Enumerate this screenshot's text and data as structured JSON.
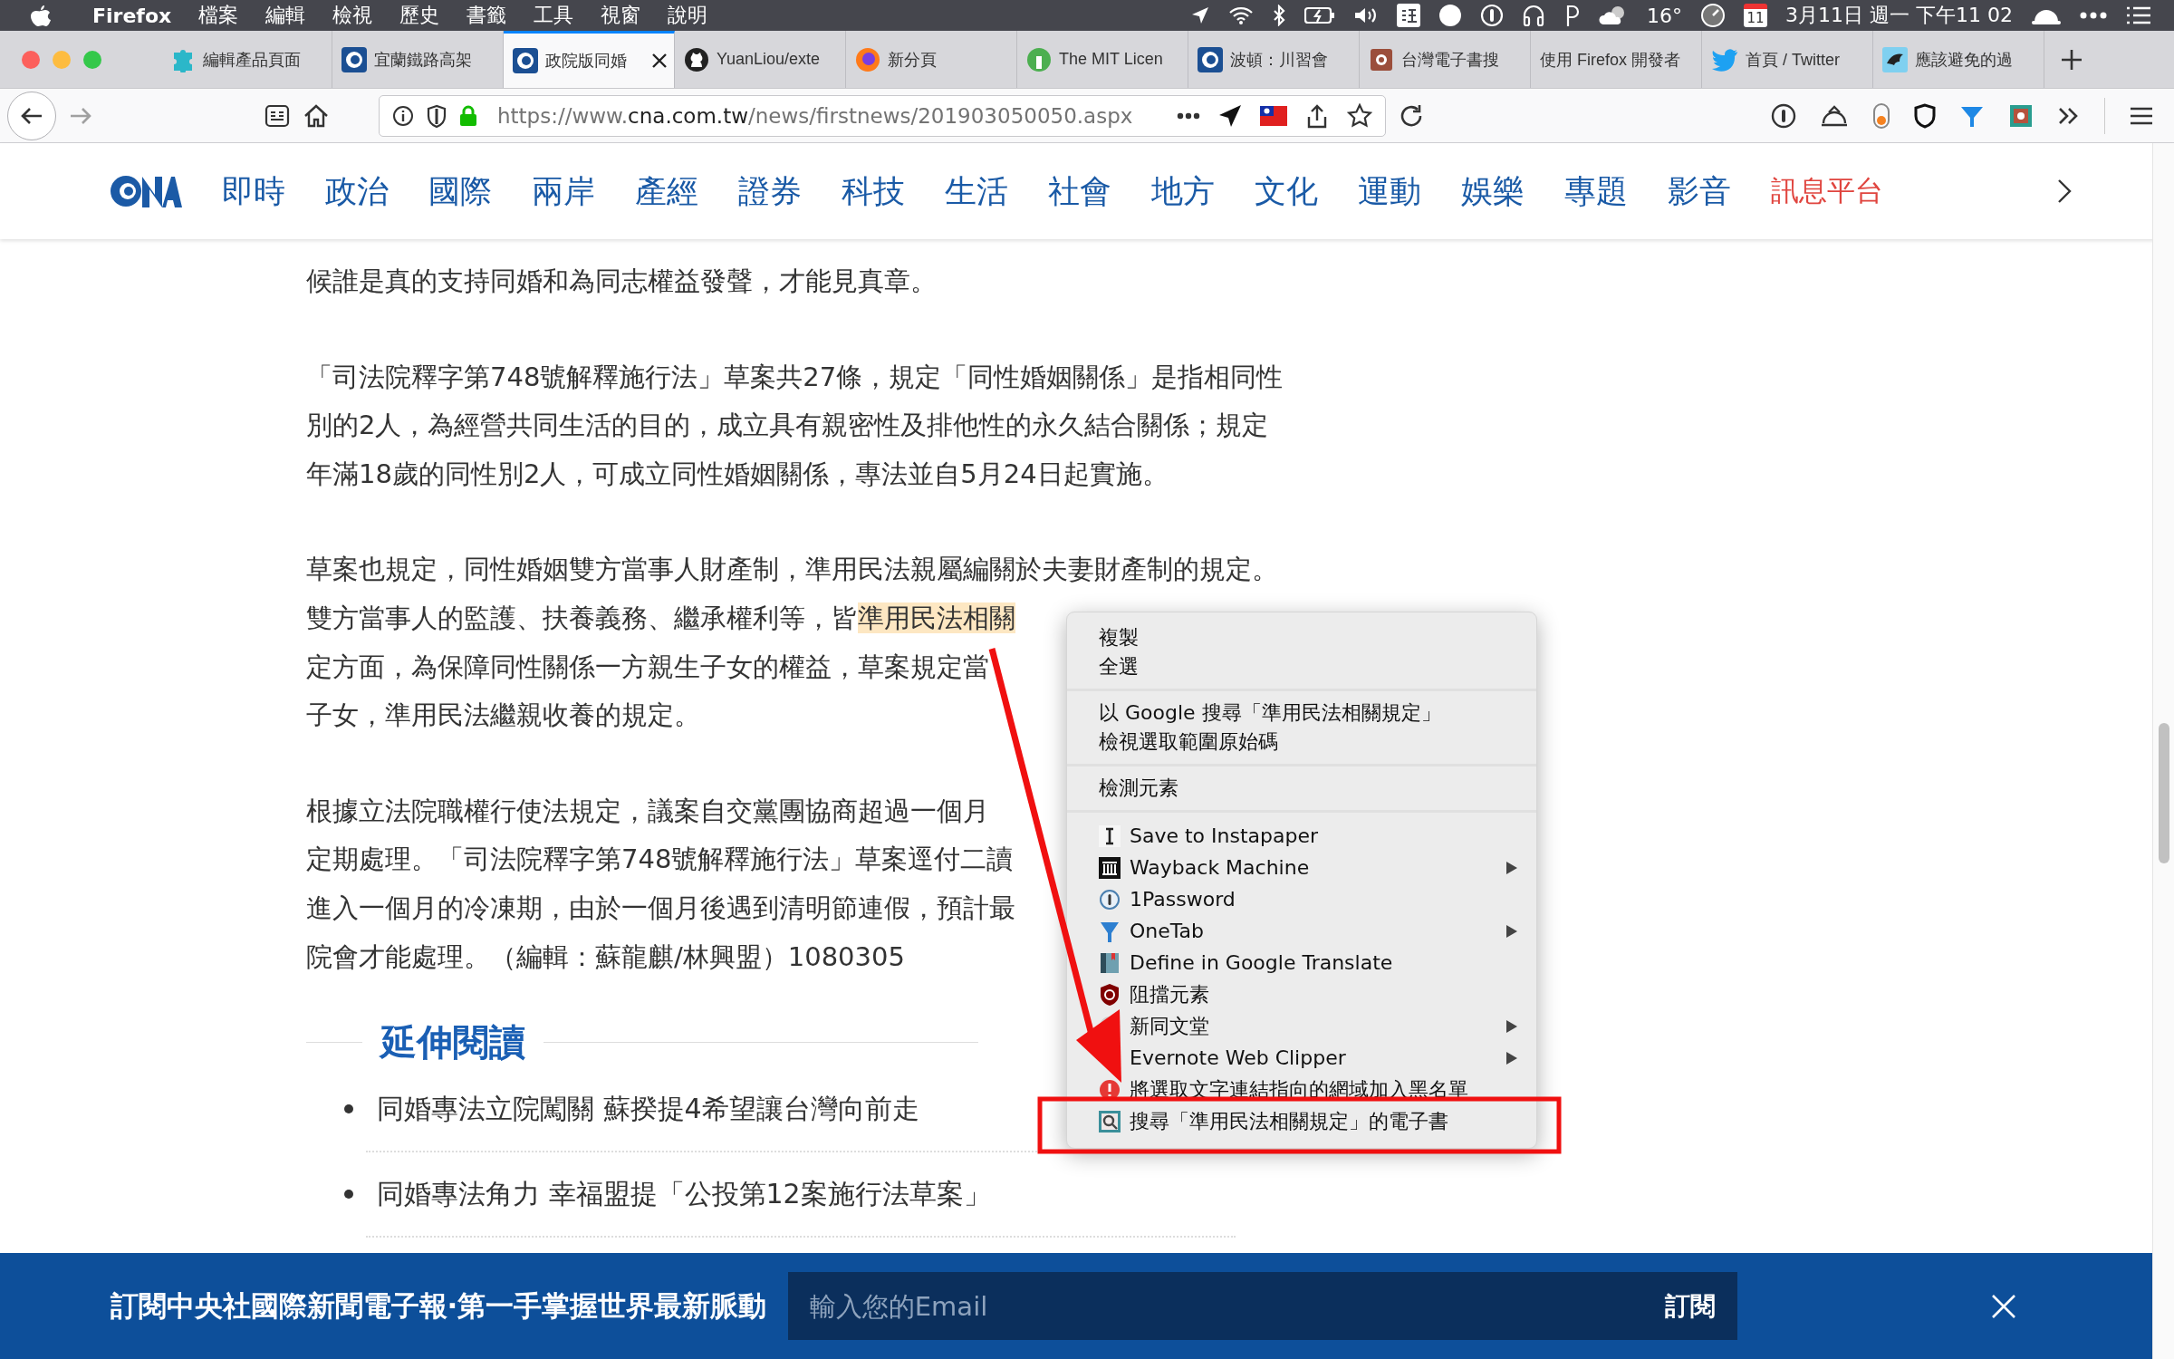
{
  "menu_bar": {
    "app": "Firefox",
    "menus": [
      "檔案",
      "編輯",
      "檢視",
      "歷史",
      "書籤",
      "工具",
      "視窗",
      "說明"
    ],
    "temperature": "16°",
    "calendar_day": "11",
    "clock": "3月11日 週一 下午11 02"
  },
  "tabs": [
    {
      "title": "編輯產品頁面",
      "kind": "puzzle",
      "selected": false
    },
    {
      "title": "宜蘭鐵路高架",
      "kind": "cna",
      "selected": false
    },
    {
      "title": "政院版同婚",
      "kind": "cna",
      "selected": true
    },
    {
      "title": "YuanLiou/exte",
      "kind": "github",
      "selected": false
    },
    {
      "title": "新分頁",
      "kind": "firefox",
      "selected": false
    },
    {
      "title": "The MIT Licen",
      "kind": "mit",
      "selected": false
    },
    {
      "title": "波頓：川習會",
      "kind": "cna",
      "selected": false
    },
    {
      "title": "台灣電子書搜",
      "kind": "book",
      "selected": false
    },
    {
      "title": "使用 Firefox 開發者",
      "kind": "none",
      "selected": false
    },
    {
      "title": "首頁 / Twitter",
      "kind": "twitter",
      "selected": false
    },
    {
      "title": "應該避免的過",
      "kind": "bird",
      "selected": false
    }
  ],
  "toolbar": {
    "url_scheme": "https://www.",
    "url_host": "cna.com.tw",
    "url_path": "/news/firstnews/201903050050.aspx"
  },
  "site_nav": {
    "items": [
      {
        "label": "即時",
        "kind": "section"
      },
      {
        "label": "政治",
        "kind": "section"
      },
      {
        "label": "國際",
        "kind": "section"
      },
      {
        "label": "兩岸",
        "kind": "section"
      },
      {
        "label": "產經",
        "kind": "section"
      },
      {
        "label": "證券",
        "kind": "section"
      },
      {
        "label": "科技",
        "kind": "section"
      },
      {
        "label": "生活",
        "kind": "section"
      },
      {
        "label": "社會",
        "kind": "section"
      },
      {
        "label": "地方",
        "kind": "section"
      },
      {
        "label": "文化",
        "kind": "section"
      },
      {
        "label": "運動",
        "kind": "section"
      },
      {
        "label": "娛樂",
        "kind": "section"
      },
      {
        "label": "專題",
        "kind": "section"
      },
      {
        "label": "影音",
        "kind": "section"
      },
      {
        "label": "訊息平台",
        "kind": "promo"
      }
    ]
  },
  "article": {
    "paragraphs": [
      [
        {
          "text": "候誰是真的支持同婚和為同志權益發聲，才能見真章。"
        }
      ],
      [
        {
          "text": "「司法院釋字第748號解釋施行法」草案共27條，規定「同性婚姻關係」是指相同性"
        },
        {
          "text": "別的2人，為經營共同生活的目的，成立具有親密性及排他性的永久結合關係；規定"
        },
        {
          "text": "年滿18歲的同性別2人，可成立同性婚姻關係，專法並自5月24日起實施。"
        }
      ],
      [
        {
          "text": "草案也規定，同性婚姻雙方當事人財產制，準用民法親屬編關於夫妻財產制的規定。"
        },
        {
          "text": "雙方當事人的監護、扶養義務、繼承權利等，皆",
          "highlight": "準用民法相關"
        },
        {
          "text": "定方面，為保障同性關係一方親生子女的權益，草案規定當"
        },
        {
          "text": "子女，準用民法繼親收養的規定。"
        }
      ],
      [
        {
          "text": "根據立法院職權行使法規定，議案自交黨團協商超過一個月"
        },
        {
          "text": "定期處理。「司法院釋字第748號解釋施行法」草案逕付二讀"
        },
        {
          "text": "進入一個月的冷凍期，由於一個月後遇到清明節連假，預計最"
        },
        {
          "text": "院會才能處理。（編輯：蘇龍麒/林興盟）1080305"
        }
      ]
    ]
  },
  "related": {
    "heading": "延伸閱讀",
    "items": [
      "同婚專法立院闖關 蘇揆提4希望讓台灣向前走",
      "同婚專法角力 幸福盟提「公投第12案施行法草案」"
    ]
  },
  "context_menu": {
    "groups": [
      [
        {
          "label": "複製",
          "kind": "plain",
          "submenu": false
        },
        {
          "label": "全選",
          "kind": "plain",
          "submenu": false
        }
      ],
      [
        {
          "label": "以 Google 搜尋「準用民法相關規定」",
          "kind": "plain",
          "submenu": false
        },
        {
          "label": "檢視選取範圍原始碼",
          "kind": "plain",
          "submenu": false
        }
      ],
      [
        {
          "label": "檢測元素",
          "kind": "plain",
          "submenu": false
        }
      ],
      [
        {
          "label": "Save to Instapaper",
          "kind": "instapaper",
          "submenu": false
        },
        {
          "label": "Wayback Machine",
          "kind": "wayback",
          "submenu": true
        },
        {
          "label": "1Password",
          "kind": "password",
          "submenu": false
        },
        {
          "label": "OneTab",
          "kind": "onetab",
          "submenu": true
        },
        {
          "label": "Define in Google Translate",
          "kind": "translate",
          "submenu": false
        },
        {
          "label": "阻擋元素",
          "kind": "ublock",
          "submenu": false
        },
        {
          "label": "新同文堂",
          "kind": "tongwen",
          "submenu": true
        },
        {
          "label": "Evernote Web Clipper",
          "kind": "evernote",
          "submenu": true
        },
        {
          "label": "將選取文字連結指向的網域加入黑名單",
          "kind": "blacklist",
          "submenu": false
        },
        {
          "label": "搜尋「準用民法相關規定」的電子書",
          "kind": "ebook",
          "submenu": false
        }
      ]
    ]
  },
  "newsletter": {
    "text": "訂閱中央社國際新聞電子報‧第一手掌握世界最新脈動",
    "placeholder": "輸入您的Email",
    "button": "訂閱"
  }
}
